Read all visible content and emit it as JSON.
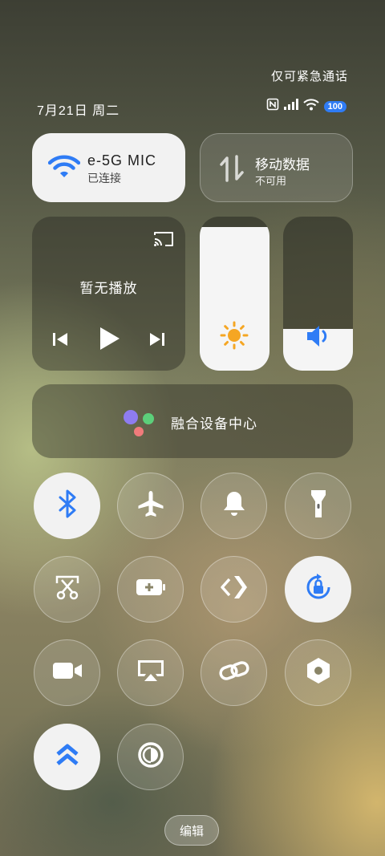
{
  "status": {
    "emergency_only": "仅可紧急通话",
    "date": "7月21日 周二",
    "battery": "100"
  },
  "wifi": {
    "ssid": "e-5G    MIC",
    "status": "已连接"
  },
  "mobile_data": {
    "title": "移动数据",
    "status": "不可用"
  },
  "media": {
    "empty_label": "暂无播放"
  },
  "brightness": {
    "level": 0.93
  },
  "volume": {
    "level": 0.27
  },
  "fusion": {
    "label": "融合设备中心"
  },
  "toggles": [
    {
      "name": "bluetooth",
      "icon": "bluetooth-icon",
      "on": true
    },
    {
      "name": "airplane-mode",
      "icon": "airplane-icon",
      "on": false
    },
    {
      "name": "ring-mode",
      "icon": "bell-icon",
      "on": false
    },
    {
      "name": "flashlight",
      "icon": "flashlight-icon",
      "on": false
    },
    {
      "name": "screenshot",
      "icon": "scissors-icon",
      "on": false
    },
    {
      "name": "power-saving",
      "icon": "battery-plus-icon",
      "on": false
    },
    {
      "name": "nearby-share",
      "icon": "share-icon",
      "on": false
    },
    {
      "name": "rotation-lock",
      "icon": "rotation-lock-icon",
      "on": true
    },
    {
      "name": "screen-record",
      "icon": "video-camera-icon",
      "on": false
    },
    {
      "name": "screen-cast",
      "icon": "cast-icon",
      "on": false
    },
    {
      "name": "link",
      "icon": "link-icon",
      "on": false
    },
    {
      "name": "nfc",
      "icon": "hexagon-icon",
      "on": false
    },
    {
      "name": "super-speed",
      "icon": "double-chevron-up-icon",
      "on": true
    },
    {
      "name": "eye-comfort",
      "icon": "contrast-icon",
      "on": false
    }
  ],
  "edit_label": "编辑",
  "colors": {
    "accent": "#2f7cf5",
    "brightness_icon": "#f5a623",
    "tile_on": "#f2f2f2"
  }
}
